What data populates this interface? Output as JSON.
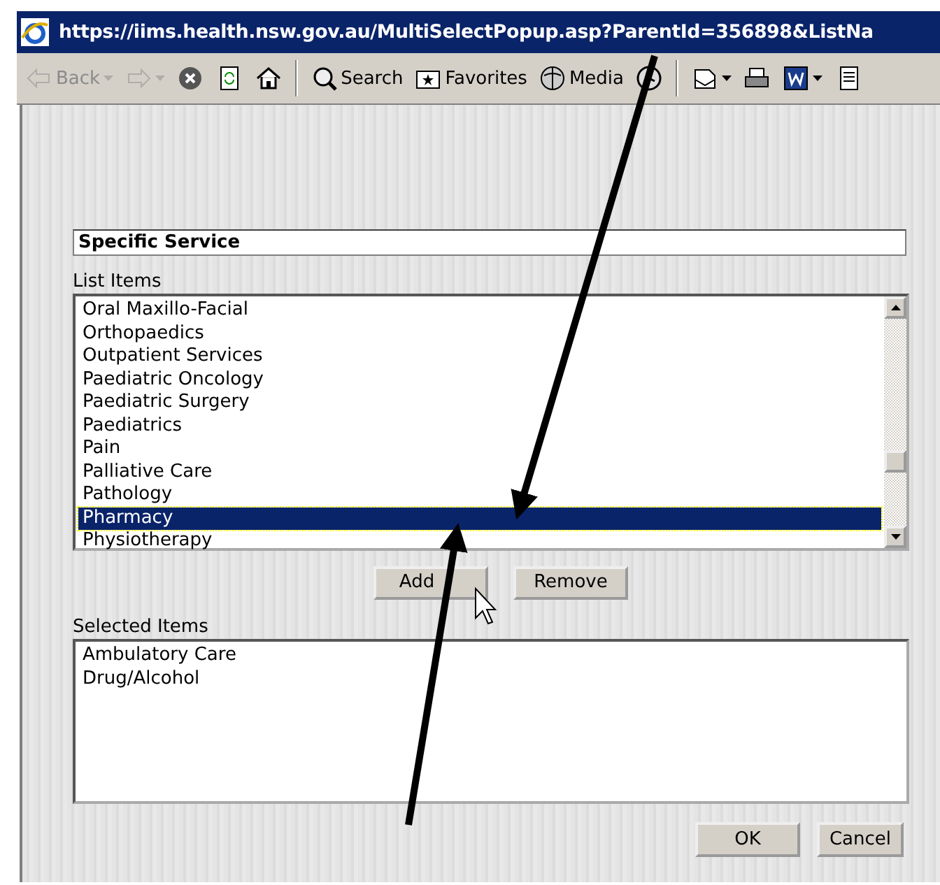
{
  "window": {
    "title": "https://iims.health.nsw.gov.au/MultiSelectPopup.asp?ParentId=356898&ListNa"
  },
  "toolbar": [
    {
      "kind": "back",
      "label": "Back",
      "disabled": true
    },
    {
      "kind": "forward",
      "disabled": true
    },
    {
      "kind": "stop",
      "disabled": false
    },
    {
      "kind": "refresh",
      "disabled": false
    },
    {
      "kind": "home",
      "disabled": false
    },
    {
      "kind": "search",
      "label": "Search",
      "disabled": false
    },
    {
      "kind": "favorites",
      "label": "Favorites",
      "disabled": false
    },
    {
      "kind": "media",
      "label": "Media",
      "disabled": false
    },
    {
      "kind": "history",
      "disabled": false
    },
    {
      "kind": "mail",
      "disabled": false
    },
    {
      "kind": "print",
      "disabled": false
    },
    {
      "kind": "word",
      "disabled": false
    },
    {
      "kind": "edit",
      "disabled": false
    }
  ],
  "field": {
    "value": "Specific Service"
  },
  "list_items": {
    "label": "List Items",
    "items": [
      {
        "text": "Oral Maxillo-Facial",
        "selected": false
      },
      {
        "text": "Orthopaedics",
        "selected": false
      },
      {
        "text": "Outpatient Services",
        "selected": false
      },
      {
        "text": "Paediatric Oncology",
        "selected": false
      },
      {
        "text": "Paediatric Surgery",
        "selected": false
      },
      {
        "text": "Paediatrics",
        "selected": false
      },
      {
        "text": "Pain",
        "selected": false
      },
      {
        "text": "Palliative Care",
        "selected": false
      },
      {
        "text": "Pathology",
        "selected": false
      },
      {
        "text": "Pharmacy",
        "selected": true
      },
      {
        "text": "Physiotherapy",
        "selected": false
      }
    ]
  },
  "list_buttons": [
    "Add",
    "Remove"
  ],
  "selected_items": {
    "label": "Selected Items",
    "items": [
      "Ambulatory Care",
      "Drug/Alcohol"
    ]
  },
  "dialog_buttons": [
    "OK",
    "Cancel"
  ]
}
